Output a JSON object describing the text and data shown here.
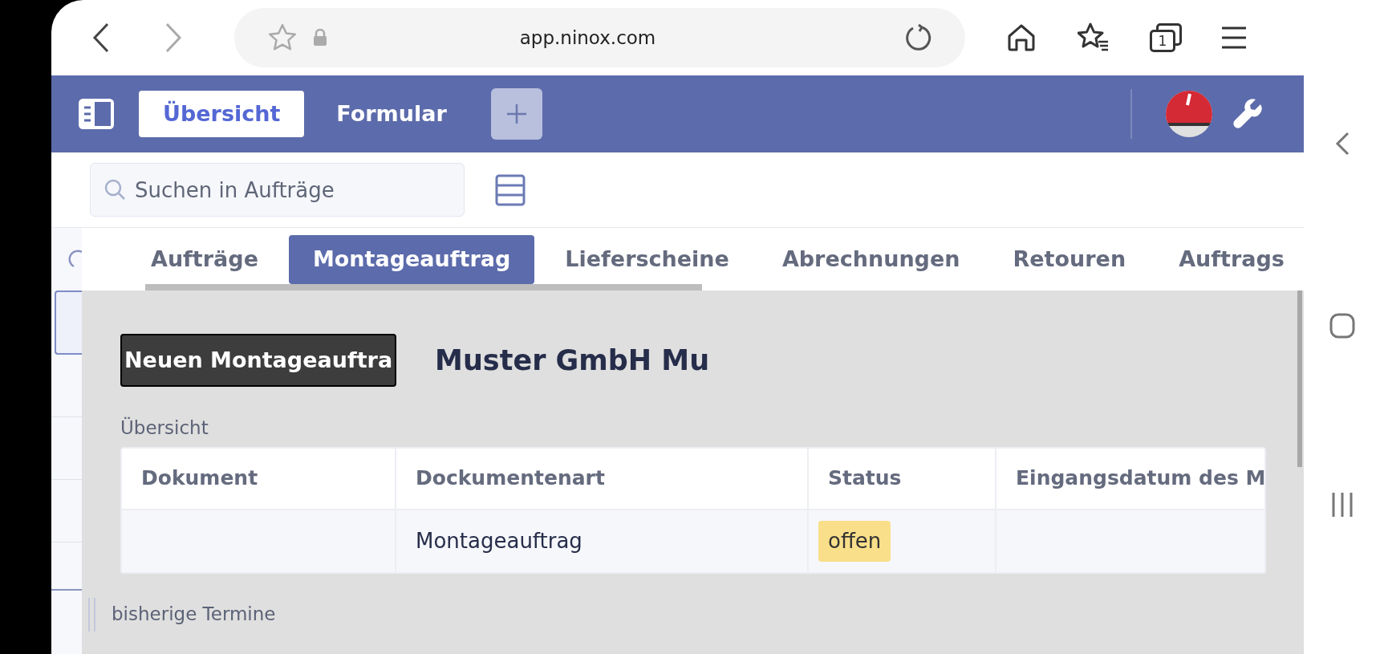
{
  "browser": {
    "url": "app.ninox.com",
    "tab_count": "1"
  },
  "header": {
    "tabs": [
      {
        "label": "Übersicht",
        "selected": true
      },
      {
        "label": "Formular",
        "selected": false
      }
    ]
  },
  "search": {
    "placeholder": "Suchen in Aufträge"
  },
  "record_tabs": [
    {
      "label": "Aufträge",
      "selected": false
    },
    {
      "label": "Montageauftrag",
      "selected": true
    },
    {
      "label": "Lieferscheine",
      "selected": false
    },
    {
      "label": "Abrechnungen",
      "selected": false
    },
    {
      "label": "Retouren",
      "selected": false
    },
    {
      "label": "Auftrags",
      "selected": false
    }
  ],
  "form": {
    "button": "Neuen Montageauftra",
    "title": "Muster GmbH Mu",
    "section_label": "Übersicht",
    "table": {
      "columns": [
        "Dokument",
        "Dockumentenart",
        "Status",
        "Eingangsdatum des M"
      ],
      "rows": [
        [
          "",
          "Montageauftrag",
          "offen",
          ""
        ]
      ]
    },
    "next_section": "bisherige Termine"
  }
}
